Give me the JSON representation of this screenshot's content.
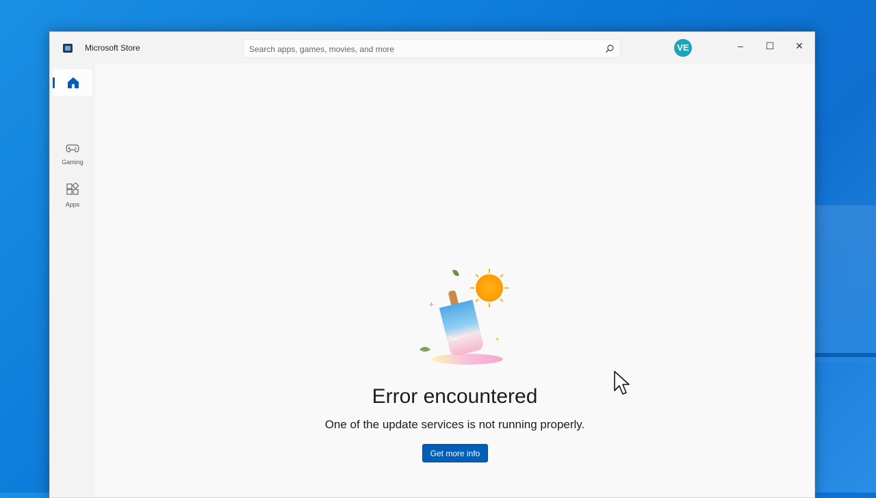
{
  "window": {
    "app_title": "Microsoft Store",
    "avatar_initials": "VE",
    "controls": {
      "minimize": "–",
      "maximize": "☐",
      "close": "✕"
    }
  },
  "search": {
    "placeholder": "Search apps, games, movies, and more",
    "value": "",
    "icon": "search-icon"
  },
  "sidebar": {
    "items": [
      {
        "label": "",
        "icon": "home-icon",
        "selected": true
      },
      {
        "label": "Gaming",
        "icon": "gamepad-icon",
        "selected": false
      },
      {
        "label": "Apps",
        "icon": "apps-grid-icon",
        "selected": false
      }
    ]
  },
  "error": {
    "title": "Error encountered",
    "message": "One of the update services is not running properly.",
    "button_label": "Get more info",
    "illustration": "melting-popsicle-illustration"
  },
  "colors": {
    "desktop": "#0c78d8",
    "accent": "#005fb8",
    "window_bg": "#f9f9f9",
    "avatar": "#1fa3b9"
  }
}
